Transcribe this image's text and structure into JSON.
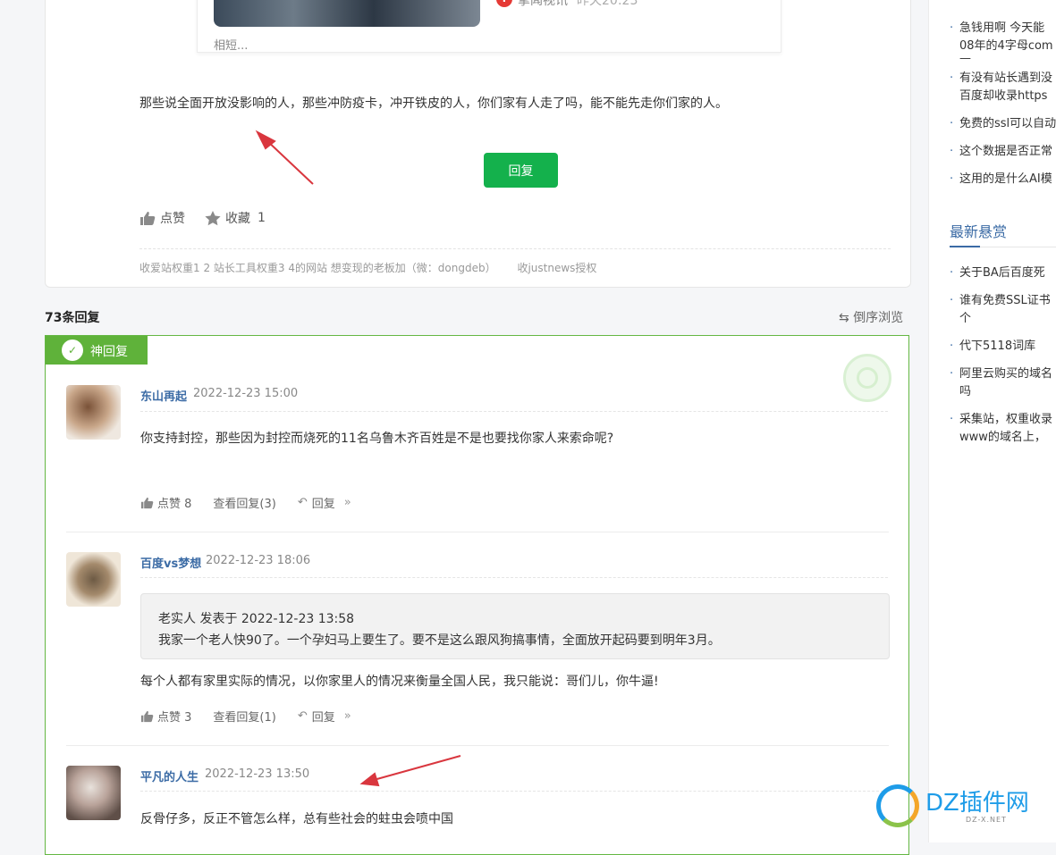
{
  "embed": {
    "source": "掌闻视讯",
    "time": "昨天20:23",
    "cut_text": "相短..."
  },
  "post": {
    "text": "那些说全面开放没影响的人，那些冲防疫卡，冲开铁皮的人，你们家有人走了吗，能不能先走你们家的人。",
    "reply_button": "回复",
    "like_label": "点赞",
    "fav_label": "收藏",
    "fav_count": "1",
    "footer": [
      "收爱站权重1 2 站长工具权重3 4的网站  想变现的老板加（微：dongdeb）",
      "收justnews授权"
    ]
  },
  "replies_header": {
    "count": "73条回复",
    "sort": "倒序浏览"
  },
  "god_reply": {
    "badge": "神回复",
    "replies": [
      {
        "user": "东山再起",
        "time": "2022-12-23 15:00",
        "text": "你支持封控，那些因为封控而烧死的11名乌鲁木齐百姓是不是也要找你家人来索命呢?",
        "like": "点赞 8",
        "view": "查看回复(3)",
        "reply": "回复"
      },
      {
        "user": "百度vs梦想",
        "time": "2022-12-23 18:06",
        "quote_head": "老实人 发表于 2022-12-23 13:58",
        "quote_body": "我家一个老人快90了。一个孕妇马上要生了。要不是这么跟风狗搞事情，全面放开起码要到明年3月。",
        "text": "每个人都有家里实际的情况，以你家里人的情况来衡量全国人民，我只能说：哥们儿，你牛逼!",
        "like": "点赞 3",
        "view": "查看回复(1)",
        "reply": "回复"
      },
      {
        "user": "平凡的人生",
        "time": "2022-12-23 13:50",
        "text": "反骨仔多，反正不管怎么样，总有些社会的蛀虫会喷中国"
      }
    ]
  },
  "sidebar": {
    "items_top": [
      [
        "急钱用啊 今天能",
        "08年的4字母com",
        "—"
      ],
      [
        "有没有站长遇到没",
        "百度却收录https"
      ],
      [
        "免费的ssl可以自动"
      ],
      [
        "这个数据是否正常"
      ],
      [
        "这用的是什么AI模"
      ]
    ],
    "section_title": "最新悬赏",
    "items_bottom": [
      [
        "关于BA后百度死"
      ],
      [
        "谁有免费SSL证书",
        "个"
      ],
      [
        "代下5118词库"
      ],
      [
        "阿里云购买的域名",
        "吗"
      ],
      [
        "采集站，权重收录",
        "www的域名上，"
      ]
    ]
  },
  "watermark": {
    "brand": "DZ插件网",
    "domain": "DZ-X.NET"
  },
  "colors": {
    "green": "#14b14c",
    "god_green": "#5fb23a",
    "link_blue": "#3b6ba5",
    "arrow_red": "#d9363e"
  }
}
